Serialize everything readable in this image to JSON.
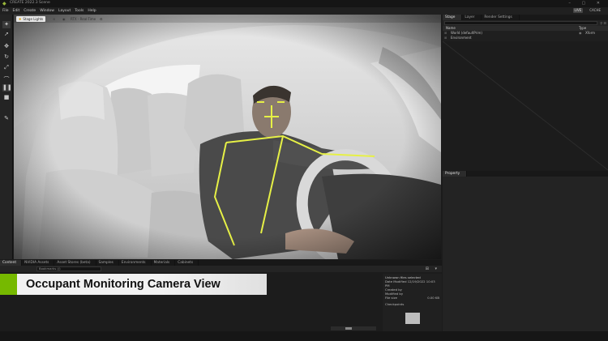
{
  "titlebar": {
    "title": "CREATE  2022.3  Scene",
    "window_controls": "– ▢ ✕"
  },
  "menubar": {
    "items": [
      "File",
      "Edit",
      "Create",
      "Window",
      "Layout",
      "Tools",
      "Help"
    ],
    "live_label": "LIVE",
    "cache_label": "CACHE"
  },
  "viewport": {
    "stage_lights_label": "Stage Lights",
    "rtx_label": "RTX - Real-Time",
    "accent_color": "#e0a000"
  },
  "stage_panel": {
    "tabs": [
      "Stage",
      "Layer",
      "Render Settings"
    ],
    "columns": {
      "name": "Name",
      "type": "Type"
    },
    "rows": [
      {
        "name": "World (defaultPrim)",
        "type": "Xform"
      },
      {
        "name": "Environment",
        "type": ""
      }
    ]
  },
  "property_panel": {
    "tab": "Property"
  },
  "bottom_panel": {
    "tabs": [
      "Content",
      "NVIDIA Assets",
      "Asset Stores (beta)",
      "Samples",
      "Environments",
      "Materials",
      "Cabinets"
    ],
    "path_value": "Bookmarks (/)",
    "detail": {
      "selection": "Unknown files selected",
      "date": "Date Modified 12/19/2022 10:03 PM",
      "created_by": "Created by",
      "modified_by": "Modified by",
      "file_size_label": "File size",
      "file_size_value": "0.00 KB",
      "checkpoints": "Checkpoints"
    }
  },
  "caption": {
    "text": "Occupant Monitoring Camera View",
    "accent_color": "#76b900"
  },
  "skeleton": {
    "color": "#e6f046"
  }
}
